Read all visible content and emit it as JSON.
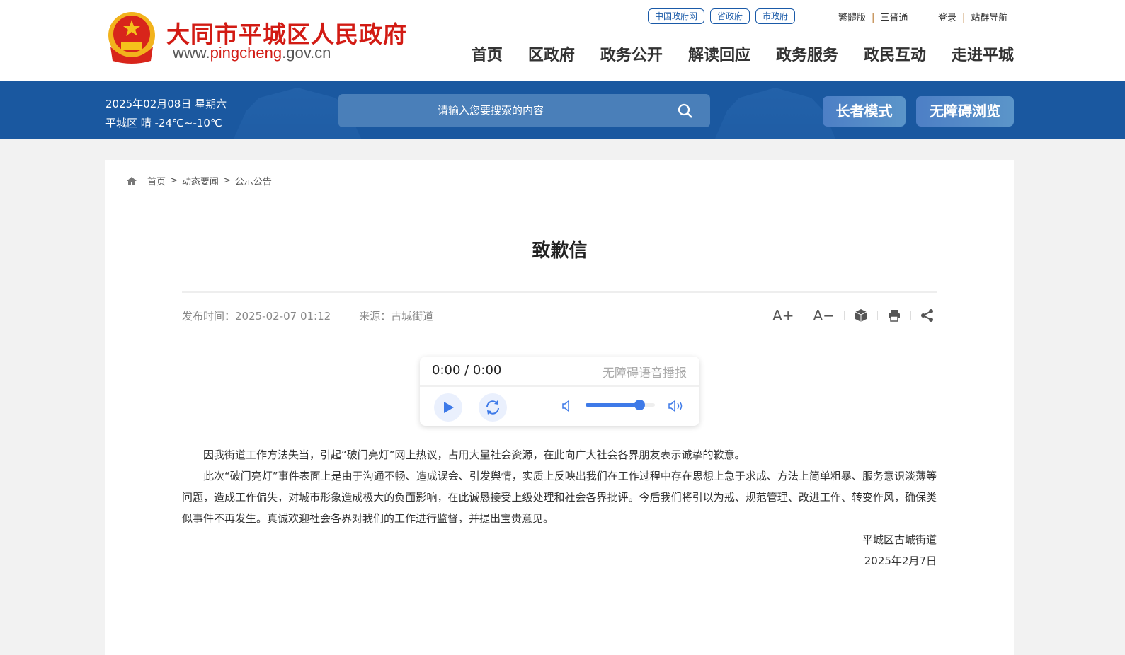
{
  "header": {
    "site_title": "大同市平城区人民政府",
    "url_prefix": "www.",
    "url_main": "pingcheng",
    "url_suffix": ".gov.cn",
    "top_links": [
      "中国政府网",
      "省政府",
      "市政府"
    ],
    "lang_links": [
      "繁體版",
      "三晋通"
    ],
    "user_links": [
      "登录",
      "站群导航"
    ],
    "nav": [
      "首页",
      "区政府",
      "政务公开",
      "解读回应",
      "政务服务",
      "政民互动",
      "走进平城"
    ]
  },
  "band": {
    "date": "2025年02月08日 星期六",
    "weather": "平城区 晴 -24℃~-10℃",
    "search_placeholder": "请输入您要搜索的内容",
    "elder_mode": "长者模式",
    "accessible": "无障碍浏览"
  },
  "breadcrumb": [
    "首页",
    "动态要闻",
    "公示公告"
  ],
  "article": {
    "title": "致歉信",
    "publish_time": "发布时间：2025-02-07 01:12",
    "source": "来源：古城街道",
    "tools": {
      "font_up": "A+",
      "font_down": "A−"
    },
    "paragraphs": [
      "因我街道工作方法失当，引起“破门亮灯”网上热议，占用大量社会资源，在此向广大社会各界朋友表示诚挚的歉意。",
      "此次“破门亮灯”事件表面上是由于沟通不畅、造成误会、引发舆情，实质上反映出我们在工作过程中存在思想上急于求成、方法上简单粗暴、服务意识淡薄等问题，造成工作偏失，对城市形象造成极大的负面影响，在此诚恳接受上级处理和社会各界批评。今后我们将引以为戒、规范管理、改进工作、转变作风，确保类似事件不再发生。真诚欢迎社会各界对我们的工作进行监督，并提出宝贵意见。"
    ],
    "signature": "平城区古城街道",
    "sign_date": "2025年2月7日"
  },
  "player": {
    "time": "0:00 / 0:00",
    "label": "无障碍语音播报",
    "volume": 0.78,
    "accent": "#3e7ae8"
  }
}
